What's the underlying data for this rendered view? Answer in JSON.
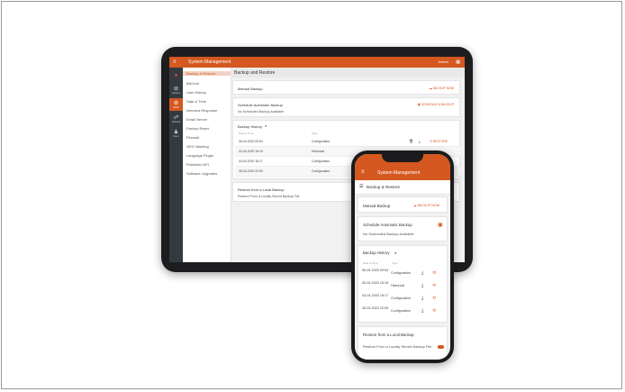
{
  "tablet": {
    "app_title": "System Management",
    "user": "Admin",
    "rail": [
      {
        "icon": "logo-icon",
        "label": ""
      },
      {
        "icon": "dashboard-icon",
        "label": "Devices"
      },
      {
        "icon": "gear-icon",
        "label": "Admin"
      },
      {
        "icon": "network-icon",
        "label": "Network"
      },
      {
        "icon": "users-icon",
        "label": "Users"
      }
    ],
    "menu": [
      "Backup & Restore",
      "BACnet",
      "User History",
      "Date & Time",
      "Demand Response",
      "Email Server",
      "Factory Reset",
      "Firewall",
      "GEO Warning",
      "Language Plugin",
      "Published API",
      "Software Upgrades"
    ],
    "header": "Backup and Restore",
    "manual_backup": {
      "title": "Manual Backup",
      "button": "BACKUP NOW"
    },
    "schedule": {
      "title": "Schedule Automatic Backup",
      "text": "No Scheduled Backup Available",
      "button": "SCHEDULE A BACKUP"
    },
    "history": {
      "title": "Backup History",
      "columns": [
        "Date & Time",
        "Type"
      ],
      "rows": [
        {
          "date": "06-04-2020 09:54",
          "type": "Configuration",
          "restore": "RESTORE"
        },
        {
          "date": "03-04-2020 16:15",
          "type": "Historical",
          "restore": ""
        },
        {
          "date": "03-04-2020 18:17",
          "type": "Configuration",
          "restore": ""
        },
        {
          "date": "28-03-2020 22:59",
          "type": "Configuration",
          "restore": ""
        }
      ]
    },
    "restore_local": {
      "title": "Restore from a Local Backup",
      "text": "Restore From a Locally Stored Backup File"
    }
  },
  "phone": {
    "app_title": "System Management",
    "sub_title": "Backup & Restore",
    "manual_backup": {
      "title": "Manual Backup",
      "button": "BACKUP NOW"
    },
    "schedule": {
      "title": "Schedule Automatic Backup",
      "text": "No Scheduled Backup Available"
    },
    "history": {
      "title": "Backup History",
      "columns": [
        "Date & Time",
        "Type"
      ],
      "rows": [
        {
          "date": "06-04-2020 09:54",
          "type": "Configuration"
        },
        {
          "date": "05-04-2020 16:15",
          "type": "Historical"
        },
        {
          "date": "03-04-2020 18:17",
          "type": "Configuration"
        },
        {
          "date": "28-03-2020 22:59",
          "type": "Configuration"
        }
      ]
    },
    "restore_local": {
      "title": "Restore from a Local Backup",
      "text": "Restore From a Locally Stored Backup File"
    }
  },
  "colors": {
    "accent": "#d4581f",
    "rail": "#353a3f",
    "device": "#1d1d1f"
  }
}
